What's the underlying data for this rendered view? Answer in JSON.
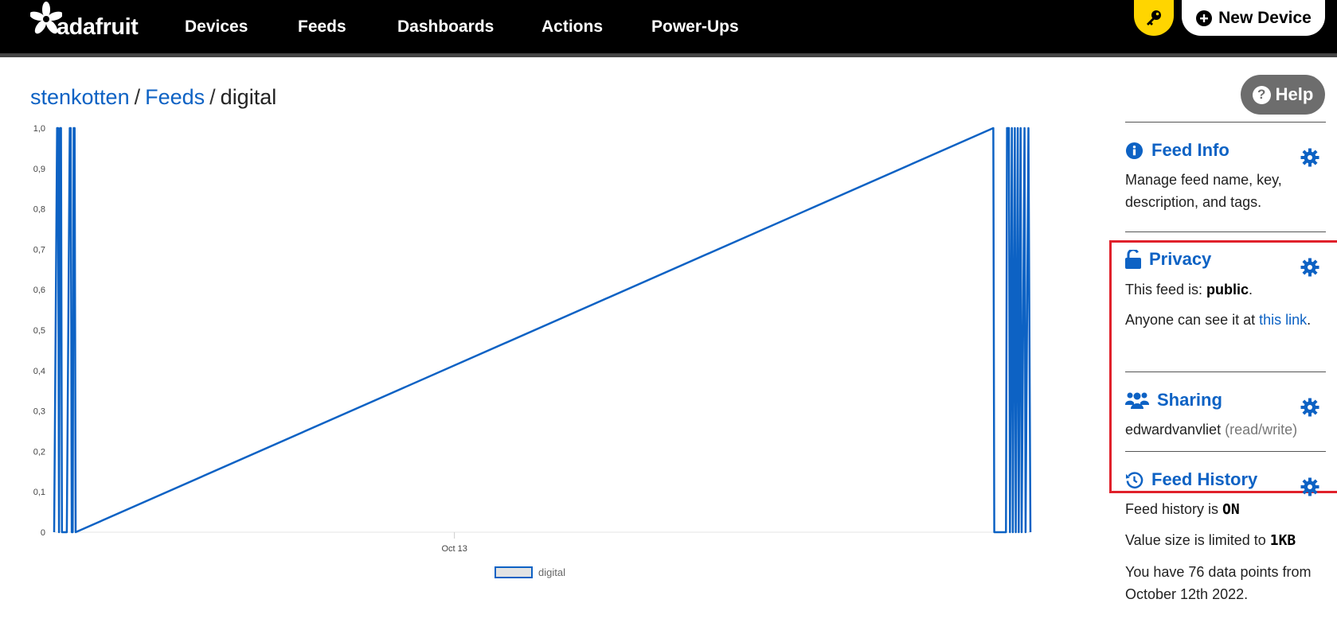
{
  "header": {
    "logo_text": "adafruit",
    "nav": [
      "Devices",
      "Feeds",
      "Dashboards",
      "Actions",
      "Power-Ups"
    ],
    "new_device_label": "New Device"
  },
  "breadcrumb": {
    "user": "stenkotten",
    "sep1": "/",
    "feeds": "Feeds",
    "sep2": "/",
    "current": "digital"
  },
  "help_label": "Help",
  "chart_data": {
    "type": "line",
    "series": [
      {
        "name": "digital",
        "points": [
          [
            0.0,
            0
          ],
          [
            0.003,
            1
          ],
          [
            0.004,
            1
          ],
          [
            0.005,
            0
          ],
          [
            0.006,
            1
          ],
          [
            0.007,
            1
          ],
          [
            0.008,
            0
          ],
          [
            0.013,
            0
          ],
          [
            0.016,
            1
          ],
          [
            0.017,
            1
          ],
          [
            0.018,
            0
          ],
          [
            0.019,
            0
          ],
          [
            0.02,
            1
          ],
          [
            0.021,
            1
          ],
          [
            0.022,
            0
          ],
          [
            0.962,
            1
          ],
          [
            0.963,
            0
          ],
          [
            0.975,
            0
          ],
          [
            0.976,
            1
          ],
          [
            0.978,
            1
          ],
          [
            0.979,
            0
          ],
          [
            0.981,
            1
          ],
          [
            0.982,
            0
          ],
          [
            0.984,
            1
          ],
          [
            0.985,
            0
          ],
          [
            0.987,
            1
          ],
          [
            0.988,
            0
          ],
          [
            0.99,
            1
          ],
          [
            0.991,
            0
          ],
          [
            0.994,
            1
          ],
          [
            0.995,
            0
          ],
          [
            0.998,
            1
          ],
          [
            1.0,
            0
          ]
        ]
      }
    ],
    "y_ticks": [
      "1,0",
      "0,9",
      "0,8",
      "0,7",
      "0,6",
      "0,5",
      "0,4",
      "0,3",
      "0,2",
      "0,1",
      "0"
    ],
    "x_ticks": [
      {
        "label": "Oct 13",
        "pos": 0.41
      }
    ],
    "ylim": [
      0,
      1
    ],
    "legend": "bottom-center",
    "color": "#0d62c4"
  },
  "sidebar": {
    "feed_info": {
      "title": "Feed Info",
      "text": "Manage feed name, key, description, and tags."
    },
    "privacy": {
      "title": "Privacy",
      "line1_prefix": "This feed is: ",
      "line1_value": "public",
      "line1_suffix": ".",
      "line2_prefix": "Anyone can see it at ",
      "line2_link": "this link",
      "line2_suffix": "."
    },
    "sharing": {
      "title": "Sharing",
      "user": "edwardvanvliet",
      "role": "(read/write)"
    },
    "history": {
      "title": "Feed History",
      "line1_prefix": "Feed history is ",
      "line1_value": "ON",
      "line2_prefix": "Value size is limited to ",
      "line2_value": "1KB",
      "line3": "You have 76 data points from October 12th 2022."
    }
  },
  "colors": {
    "accent": "#0d62c4",
    "highlight": "#e0212b",
    "topbar": "#000000",
    "key_button": "#ffd500"
  }
}
